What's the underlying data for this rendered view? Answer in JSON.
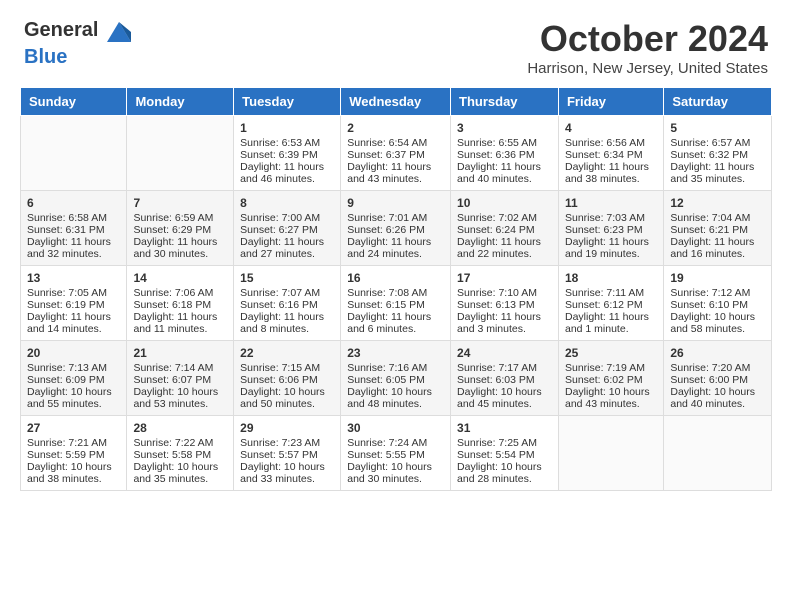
{
  "header": {
    "logo_line1": "General",
    "logo_line2": "Blue",
    "month_title": "October 2024",
    "location": "Harrison, New Jersey, United States"
  },
  "days_of_week": [
    "Sunday",
    "Monday",
    "Tuesday",
    "Wednesday",
    "Thursday",
    "Friday",
    "Saturday"
  ],
  "weeks": [
    [
      {
        "day": "",
        "sunrise": "",
        "sunset": "",
        "daylight": ""
      },
      {
        "day": "",
        "sunrise": "",
        "sunset": "",
        "daylight": ""
      },
      {
        "day": "1",
        "sunrise": "Sunrise: 6:53 AM",
        "sunset": "Sunset: 6:39 PM",
        "daylight": "Daylight: 11 hours and 46 minutes."
      },
      {
        "day": "2",
        "sunrise": "Sunrise: 6:54 AM",
        "sunset": "Sunset: 6:37 PM",
        "daylight": "Daylight: 11 hours and 43 minutes."
      },
      {
        "day": "3",
        "sunrise": "Sunrise: 6:55 AM",
        "sunset": "Sunset: 6:36 PM",
        "daylight": "Daylight: 11 hours and 40 minutes."
      },
      {
        "day": "4",
        "sunrise": "Sunrise: 6:56 AM",
        "sunset": "Sunset: 6:34 PM",
        "daylight": "Daylight: 11 hours and 38 minutes."
      },
      {
        "day": "5",
        "sunrise": "Sunrise: 6:57 AM",
        "sunset": "Sunset: 6:32 PM",
        "daylight": "Daylight: 11 hours and 35 minutes."
      }
    ],
    [
      {
        "day": "6",
        "sunrise": "Sunrise: 6:58 AM",
        "sunset": "Sunset: 6:31 PM",
        "daylight": "Daylight: 11 hours and 32 minutes."
      },
      {
        "day": "7",
        "sunrise": "Sunrise: 6:59 AM",
        "sunset": "Sunset: 6:29 PM",
        "daylight": "Daylight: 11 hours and 30 minutes."
      },
      {
        "day": "8",
        "sunrise": "Sunrise: 7:00 AM",
        "sunset": "Sunset: 6:27 PM",
        "daylight": "Daylight: 11 hours and 27 minutes."
      },
      {
        "day": "9",
        "sunrise": "Sunrise: 7:01 AM",
        "sunset": "Sunset: 6:26 PM",
        "daylight": "Daylight: 11 hours and 24 minutes."
      },
      {
        "day": "10",
        "sunrise": "Sunrise: 7:02 AM",
        "sunset": "Sunset: 6:24 PM",
        "daylight": "Daylight: 11 hours and 22 minutes."
      },
      {
        "day": "11",
        "sunrise": "Sunrise: 7:03 AM",
        "sunset": "Sunset: 6:23 PM",
        "daylight": "Daylight: 11 hours and 19 minutes."
      },
      {
        "day": "12",
        "sunrise": "Sunrise: 7:04 AM",
        "sunset": "Sunset: 6:21 PM",
        "daylight": "Daylight: 11 hours and 16 minutes."
      }
    ],
    [
      {
        "day": "13",
        "sunrise": "Sunrise: 7:05 AM",
        "sunset": "Sunset: 6:19 PM",
        "daylight": "Daylight: 11 hours and 14 minutes."
      },
      {
        "day": "14",
        "sunrise": "Sunrise: 7:06 AM",
        "sunset": "Sunset: 6:18 PM",
        "daylight": "Daylight: 11 hours and 11 minutes."
      },
      {
        "day": "15",
        "sunrise": "Sunrise: 7:07 AM",
        "sunset": "Sunset: 6:16 PM",
        "daylight": "Daylight: 11 hours and 8 minutes."
      },
      {
        "day": "16",
        "sunrise": "Sunrise: 7:08 AM",
        "sunset": "Sunset: 6:15 PM",
        "daylight": "Daylight: 11 hours and 6 minutes."
      },
      {
        "day": "17",
        "sunrise": "Sunrise: 7:10 AM",
        "sunset": "Sunset: 6:13 PM",
        "daylight": "Daylight: 11 hours and 3 minutes."
      },
      {
        "day": "18",
        "sunrise": "Sunrise: 7:11 AM",
        "sunset": "Sunset: 6:12 PM",
        "daylight": "Daylight: 11 hours and 1 minute."
      },
      {
        "day": "19",
        "sunrise": "Sunrise: 7:12 AM",
        "sunset": "Sunset: 6:10 PM",
        "daylight": "Daylight: 10 hours and 58 minutes."
      }
    ],
    [
      {
        "day": "20",
        "sunrise": "Sunrise: 7:13 AM",
        "sunset": "Sunset: 6:09 PM",
        "daylight": "Daylight: 10 hours and 55 minutes."
      },
      {
        "day": "21",
        "sunrise": "Sunrise: 7:14 AM",
        "sunset": "Sunset: 6:07 PM",
        "daylight": "Daylight: 10 hours and 53 minutes."
      },
      {
        "day": "22",
        "sunrise": "Sunrise: 7:15 AM",
        "sunset": "Sunset: 6:06 PM",
        "daylight": "Daylight: 10 hours and 50 minutes."
      },
      {
        "day": "23",
        "sunrise": "Sunrise: 7:16 AM",
        "sunset": "Sunset: 6:05 PM",
        "daylight": "Daylight: 10 hours and 48 minutes."
      },
      {
        "day": "24",
        "sunrise": "Sunrise: 7:17 AM",
        "sunset": "Sunset: 6:03 PM",
        "daylight": "Daylight: 10 hours and 45 minutes."
      },
      {
        "day": "25",
        "sunrise": "Sunrise: 7:19 AM",
        "sunset": "Sunset: 6:02 PM",
        "daylight": "Daylight: 10 hours and 43 minutes."
      },
      {
        "day": "26",
        "sunrise": "Sunrise: 7:20 AM",
        "sunset": "Sunset: 6:00 PM",
        "daylight": "Daylight: 10 hours and 40 minutes."
      }
    ],
    [
      {
        "day": "27",
        "sunrise": "Sunrise: 7:21 AM",
        "sunset": "Sunset: 5:59 PM",
        "daylight": "Daylight: 10 hours and 38 minutes."
      },
      {
        "day": "28",
        "sunrise": "Sunrise: 7:22 AM",
        "sunset": "Sunset: 5:58 PM",
        "daylight": "Daylight: 10 hours and 35 minutes."
      },
      {
        "day": "29",
        "sunrise": "Sunrise: 7:23 AM",
        "sunset": "Sunset: 5:57 PM",
        "daylight": "Daylight: 10 hours and 33 minutes."
      },
      {
        "day": "30",
        "sunrise": "Sunrise: 7:24 AM",
        "sunset": "Sunset: 5:55 PM",
        "daylight": "Daylight: 10 hours and 30 minutes."
      },
      {
        "day": "31",
        "sunrise": "Sunrise: 7:25 AM",
        "sunset": "Sunset: 5:54 PM",
        "daylight": "Daylight: 10 hours and 28 minutes."
      },
      {
        "day": "",
        "sunrise": "",
        "sunset": "",
        "daylight": ""
      },
      {
        "day": "",
        "sunrise": "",
        "sunset": "",
        "daylight": ""
      }
    ]
  ]
}
